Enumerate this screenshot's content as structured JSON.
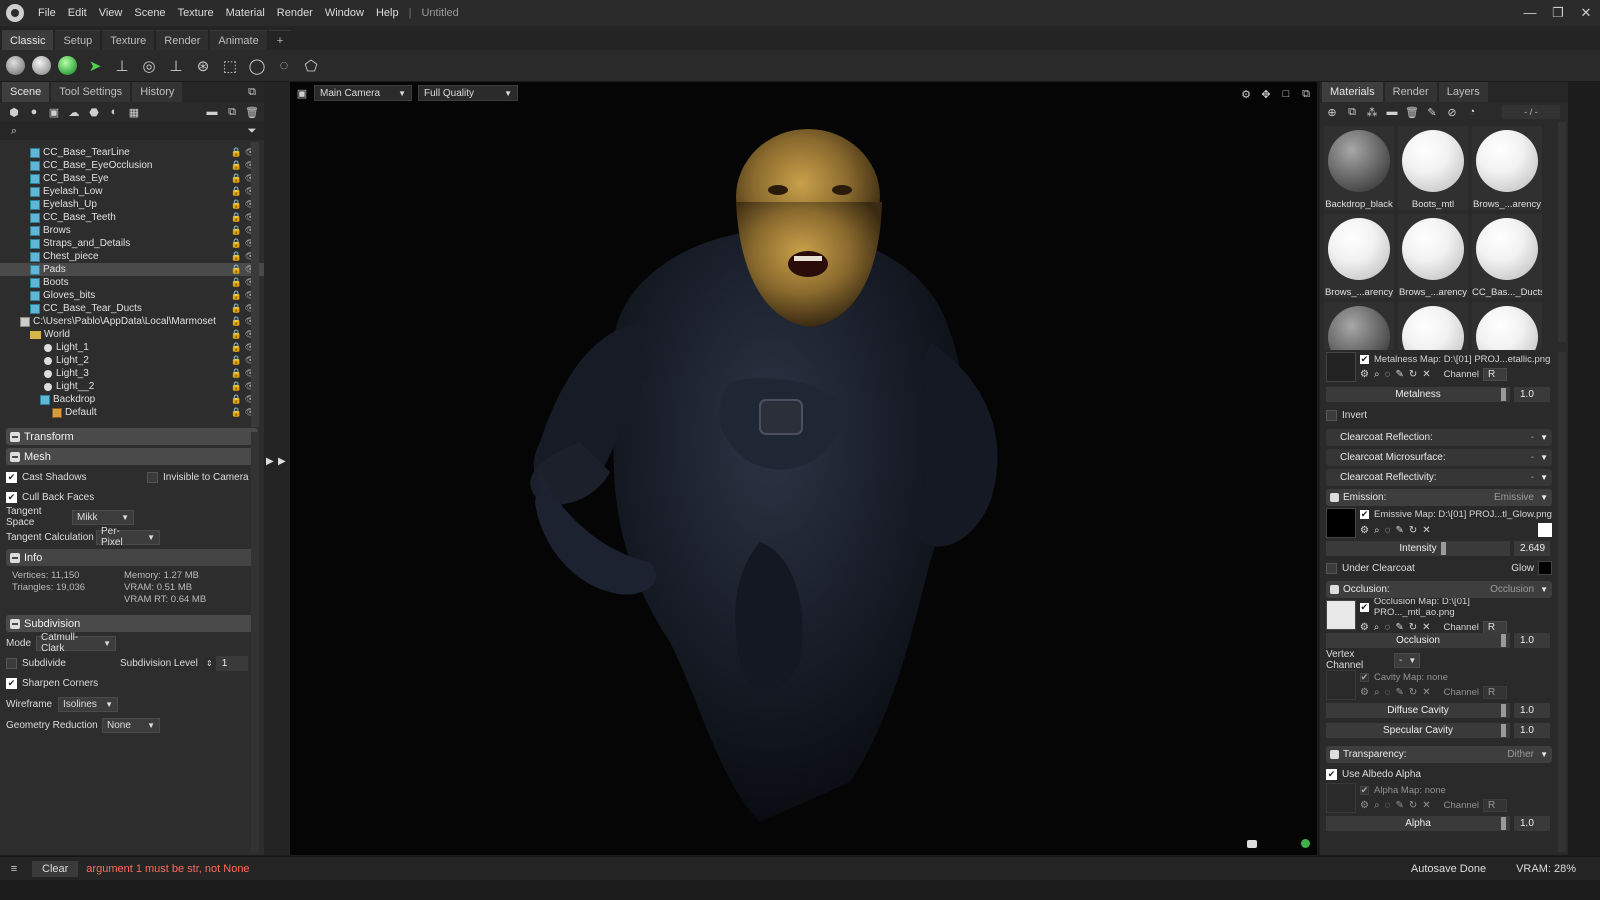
{
  "titlebar": {
    "menus": [
      "File",
      "Edit",
      "View",
      "Scene",
      "Texture",
      "Material",
      "Render",
      "Window",
      "Help"
    ],
    "separator": "|",
    "doc_title": "Untitled",
    "window_buttons": [
      "—",
      "❐",
      "✕"
    ]
  },
  "workspace_tabs": [
    "Classic",
    "Setup",
    "Texture",
    "Render",
    "Animate",
    "+"
  ],
  "left": {
    "tabs": [
      "Scene",
      "Tool Settings",
      "History"
    ],
    "tree": [
      {
        "label": "CC_Base_TearLine",
        "icon": "cube-icon"
      },
      {
        "label": "CC_Base_EyeOcclusion",
        "icon": "cube-icon"
      },
      {
        "label": "CC_Base_Eye",
        "icon": "cube-icon"
      },
      {
        "label": "Eyelash_Low",
        "icon": "cube-icon"
      },
      {
        "label": "Eyelash_Up",
        "icon": "cube-icon"
      },
      {
        "label": "CC_Base_Teeth",
        "icon": "cube-icon"
      },
      {
        "label": "Brows",
        "icon": "cube-icon"
      },
      {
        "label": "Straps_and_Details",
        "icon": "cube-icon"
      },
      {
        "label": "Chest_piece",
        "icon": "cube-icon"
      },
      {
        "label": "Pads",
        "icon": "cube-icon"
      },
      {
        "label": "Boots",
        "icon": "cube-icon"
      },
      {
        "label": "Gloves_bits",
        "icon": "cube-icon"
      },
      {
        "label": "CC_Base_Tear_Ducts",
        "icon": "cube-icon"
      },
      {
        "label": "C:\\Users\\Pablo\\AppData\\Local\\Marmoset",
        "icon": "file-icon"
      },
      {
        "label": "World",
        "icon": "folder-icon"
      },
      {
        "label": "Light_1",
        "icon": "light-icon"
      },
      {
        "label": "Light_2",
        "icon": "light-icon"
      },
      {
        "label": "Light_3",
        "icon": "light-icon"
      },
      {
        "label": "Light__2",
        "icon": "light-icon"
      },
      {
        "label": "Backdrop",
        "icon": "cube-icon"
      },
      {
        "label": "Default",
        "icon": "material-icon"
      }
    ],
    "selected": "Pads",
    "transform_label": "Transform",
    "mesh_label": "Mesh",
    "cast_shadows": "Cast Shadows",
    "invisible_to_camera": "Invisible to Camera",
    "cull_back_faces": "Cull Back Faces",
    "tangent_space_label": "Tangent Space",
    "tangent_space_value": "Mikk",
    "tangent_calc_label": "Tangent Calculation",
    "tangent_calc_value": "Per-Pixel",
    "info_label": "Info",
    "vertices": "Vertices: 11,150",
    "triangles": "Triangles: 19,036",
    "memory": "Memory: 1.27 MB",
    "vram": "VRAM: 0.51 MB",
    "vram_rt": "VRAM RT: 0.64 MB",
    "subdivision_label": "Subdivision",
    "mode_label": "Mode",
    "mode_value": "Catmull-Clark",
    "subdivide_label": "Subdivide",
    "subdiv_level_label": "Subdivision Level",
    "subdiv_level_value": "1",
    "sharpen_corners": "Sharpen Corners",
    "wireframe_label": "Wireframe",
    "wireframe_value": "Isolines",
    "geom_reduction_label": "Geometry Reduction",
    "geom_reduction_value": "None"
  },
  "viewport": {
    "camera": "Main Camera",
    "quality": "Full Quality"
  },
  "right": {
    "tabs": [
      "Materials",
      "Render",
      "Layers"
    ],
    "counter": "- / -",
    "materials": [
      {
        "name": "Backdrop_black",
        "dark": true
      },
      {
        "name": "Boots_mtl",
        "dark": false
      },
      {
        "name": "Brows_...arency",
        "dark": false
      },
      {
        "name": "Brows_...arency",
        "dark": false
      },
      {
        "name": "Brows_...arency",
        "dark": false
      },
      {
        "name": "CC_Bas..._Ducts",
        "dark": false
      }
    ],
    "metalness_map": "Metalness Map: D:\\[01] PROJ...etallic.png",
    "channel": "Channel",
    "channel_value": "R",
    "metalness": "Metalness",
    "metalness_value": "1.0",
    "invert": "Invert",
    "clearcoat_reflection": "Clearcoat Reflection:",
    "clearcoat_microsurface": "Clearcoat Microsurface:",
    "clearcoat_reflectivity": "Clearcoat Reflectivity:",
    "dash": "-",
    "emission_label": "Emission:",
    "emission_type": "Emissive",
    "emissive_map": "Emissive Map: D:\\[01] PROJ...tl_Glow.png",
    "intensity": "Intensity",
    "intensity_value": "2.649",
    "under_clearcoat": "Under Clearcoat",
    "glow": "Glow",
    "occlusion_label": "Occlusion:",
    "occlusion_type": "Occlusion",
    "occlusion_map": "Occlusion Map: D:\\[01] PRO..._mtl_ao.png",
    "occlusion": "Occlusion",
    "occlusion_value": "1.0",
    "vertex_channel": "Vertex Channel",
    "vertex_channel_value": "-",
    "cavity_map": "Cavity Map: none",
    "diffuse_cavity": "Diffuse Cavity",
    "diffuse_cavity_value": "1.0",
    "specular_cavity": "Specular Cavity",
    "specular_cavity_value": "1.0",
    "transparency_label": "Transparency:",
    "transparency_type": "Dither",
    "use_albedo_alpha": "Use Albedo Alpha",
    "alpha_map": "Alpha Map: none",
    "alpha": "Alpha",
    "alpha_value": "1.0"
  },
  "status": {
    "clear": "Clear",
    "message": "argument 1 must be str, not None",
    "autosave": "Autosave Done",
    "vram": "VRAM: 28%"
  },
  "colors": {
    "error_text": "#ff6a5a",
    "selection": "#4a4a4a",
    "accent_green": "#3fb04a"
  }
}
